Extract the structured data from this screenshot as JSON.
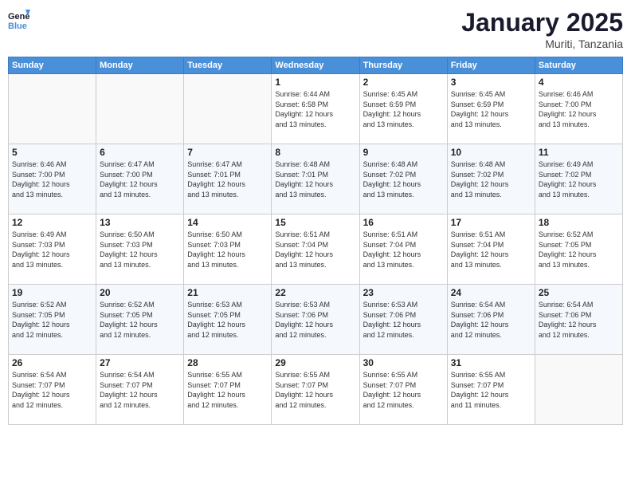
{
  "logo": {
    "line1": "General",
    "line2": "Blue"
  },
  "title": "January 2025",
  "location": "Muriti, Tanzania",
  "weekdays": [
    "Sunday",
    "Monday",
    "Tuesday",
    "Wednesday",
    "Thursday",
    "Friday",
    "Saturday"
  ],
  "weeks": [
    [
      {
        "day": "",
        "info": ""
      },
      {
        "day": "",
        "info": ""
      },
      {
        "day": "",
        "info": ""
      },
      {
        "day": "1",
        "info": "Sunrise: 6:44 AM\nSunset: 6:58 PM\nDaylight: 12 hours\nand 13 minutes."
      },
      {
        "day": "2",
        "info": "Sunrise: 6:45 AM\nSunset: 6:59 PM\nDaylight: 12 hours\nand 13 minutes."
      },
      {
        "day": "3",
        "info": "Sunrise: 6:45 AM\nSunset: 6:59 PM\nDaylight: 12 hours\nand 13 minutes."
      },
      {
        "day": "4",
        "info": "Sunrise: 6:46 AM\nSunset: 7:00 PM\nDaylight: 12 hours\nand 13 minutes."
      }
    ],
    [
      {
        "day": "5",
        "info": "Sunrise: 6:46 AM\nSunset: 7:00 PM\nDaylight: 12 hours\nand 13 minutes."
      },
      {
        "day": "6",
        "info": "Sunrise: 6:47 AM\nSunset: 7:00 PM\nDaylight: 12 hours\nand 13 minutes."
      },
      {
        "day": "7",
        "info": "Sunrise: 6:47 AM\nSunset: 7:01 PM\nDaylight: 12 hours\nand 13 minutes."
      },
      {
        "day": "8",
        "info": "Sunrise: 6:48 AM\nSunset: 7:01 PM\nDaylight: 12 hours\nand 13 minutes."
      },
      {
        "day": "9",
        "info": "Sunrise: 6:48 AM\nSunset: 7:02 PM\nDaylight: 12 hours\nand 13 minutes."
      },
      {
        "day": "10",
        "info": "Sunrise: 6:48 AM\nSunset: 7:02 PM\nDaylight: 12 hours\nand 13 minutes."
      },
      {
        "day": "11",
        "info": "Sunrise: 6:49 AM\nSunset: 7:02 PM\nDaylight: 12 hours\nand 13 minutes."
      }
    ],
    [
      {
        "day": "12",
        "info": "Sunrise: 6:49 AM\nSunset: 7:03 PM\nDaylight: 12 hours\nand 13 minutes."
      },
      {
        "day": "13",
        "info": "Sunrise: 6:50 AM\nSunset: 7:03 PM\nDaylight: 12 hours\nand 13 minutes."
      },
      {
        "day": "14",
        "info": "Sunrise: 6:50 AM\nSunset: 7:03 PM\nDaylight: 12 hours\nand 13 minutes."
      },
      {
        "day": "15",
        "info": "Sunrise: 6:51 AM\nSunset: 7:04 PM\nDaylight: 12 hours\nand 13 minutes."
      },
      {
        "day": "16",
        "info": "Sunrise: 6:51 AM\nSunset: 7:04 PM\nDaylight: 12 hours\nand 13 minutes."
      },
      {
        "day": "17",
        "info": "Sunrise: 6:51 AM\nSunset: 7:04 PM\nDaylight: 12 hours\nand 13 minutes."
      },
      {
        "day": "18",
        "info": "Sunrise: 6:52 AM\nSunset: 7:05 PM\nDaylight: 12 hours\nand 13 minutes."
      }
    ],
    [
      {
        "day": "19",
        "info": "Sunrise: 6:52 AM\nSunset: 7:05 PM\nDaylight: 12 hours\nand 12 minutes."
      },
      {
        "day": "20",
        "info": "Sunrise: 6:52 AM\nSunset: 7:05 PM\nDaylight: 12 hours\nand 12 minutes."
      },
      {
        "day": "21",
        "info": "Sunrise: 6:53 AM\nSunset: 7:05 PM\nDaylight: 12 hours\nand 12 minutes."
      },
      {
        "day": "22",
        "info": "Sunrise: 6:53 AM\nSunset: 7:06 PM\nDaylight: 12 hours\nand 12 minutes."
      },
      {
        "day": "23",
        "info": "Sunrise: 6:53 AM\nSunset: 7:06 PM\nDaylight: 12 hours\nand 12 minutes."
      },
      {
        "day": "24",
        "info": "Sunrise: 6:54 AM\nSunset: 7:06 PM\nDaylight: 12 hours\nand 12 minutes."
      },
      {
        "day": "25",
        "info": "Sunrise: 6:54 AM\nSunset: 7:06 PM\nDaylight: 12 hours\nand 12 minutes."
      }
    ],
    [
      {
        "day": "26",
        "info": "Sunrise: 6:54 AM\nSunset: 7:07 PM\nDaylight: 12 hours\nand 12 minutes."
      },
      {
        "day": "27",
        "info": "Sunrise: 6:54 AM\nSunset: 7:07 PM\nDaylight: 12 hours\nand 12 minutes."
      },
      {
        "day": "28",
        "info": "Sunrise: 6:55 AM\nSunset: 7:07 PM\nDaylight: 12 hours\nand 12 minutes."
      },
      {
        "day": "29",
        "info": "Sunrise: 6:55 AM\nSunset: 7:07 PM\nDaylight: 12 hours\nand 12 minutes."
      },
      {
        "day": "30",
        "info": "Sunrise: 6:55 AM\nSunset: 7:07 PM\nDaylight: 12 hours\nand 12 minutes."
      },
      {
        "day": "31",
        "info": "Sunrise: 6:55 AM\nSunset: 7:07 PM\nDaylight: 12 hours\nand 11 minutes."
      },
      {
        "day": "",
        "info": ""
      }
    ]
  ]
}
